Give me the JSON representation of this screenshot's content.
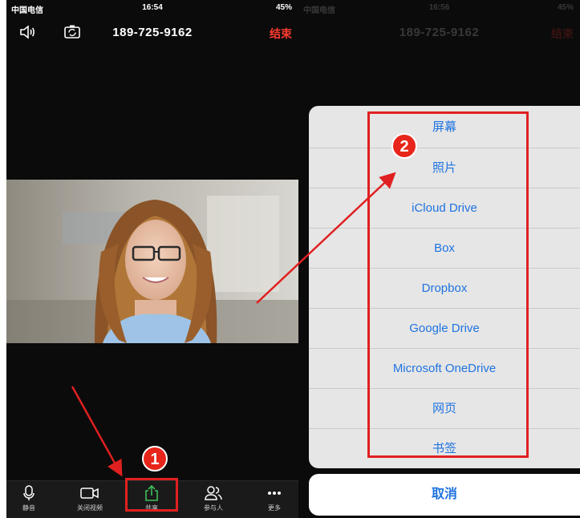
{
  "status": {
    "carrier": "中国电信",
    "time": "16:54",
    "battery": "45%"
  },
  "status_dim": {
    "carrier": "中国电信",
    "time": "16:56",
    "battery": "45%"
  },
  "call": {
    "number": "189-725-9162",
    "end_label": "结束"
  },
  "toolbar": {
    "mute": "静音",
    "stop_video": "关闭视频",
    "share": "共享",
    "participants": "参与人",
    "more": "更多"
  },
  "share_sheet": {
    "options": [
      "屏幕",
      "照片",
      "iCloud Drive",
      "Box",
      "Dropbox",
      "Google Drive",
      "Microsoft OneDrive",
      "网页",
      "书签"
    ],
    "cancel": "取消"
  },
  "annotations": {
    "step1": "1",
    "step2": "2"
  },
  "colors": {
    "end": "#ff3b30",
    "link_blue": "#1f73e0",
    "highlight_red": "#e02020",
    "share_icon_green": "#3fbf5a"
  }
}
